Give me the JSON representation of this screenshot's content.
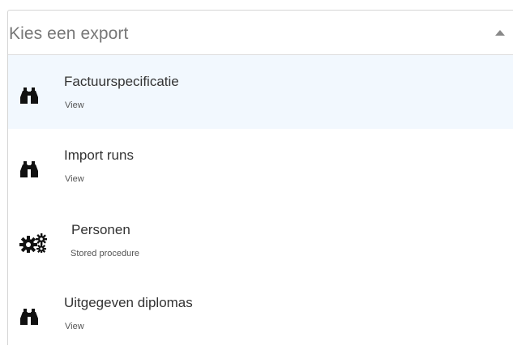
{
  "select": {
    "placeholder": "Kies een export",
    "options": [
      {
        "title": "Factuurspecificatie",
        "type": "View",
        "icon": "binoculars-icon",
        "highlighted": true
      },
      {
        "title": "Import runs",
        "type": "View",
        "icon": "binoculars-icon",
        "highlighted": false
      },
      {
        "title": "Personen",
        "type": "Stored procedure",
        "icon": "cogs-icon",
        "highlighted": false
      },
      {
        "title": "Uitgegeven diplomas",
        "type": "View",
        "icon": "binoculars-icon",
        "highlighted": false
      }
    ]
  },
  "colors": {
    "highlight_bg": "#f2f8fe",
    "border": "#d5d5d5",
    "text": "#333333",
    "placeholder": "#777777"
  }
}
